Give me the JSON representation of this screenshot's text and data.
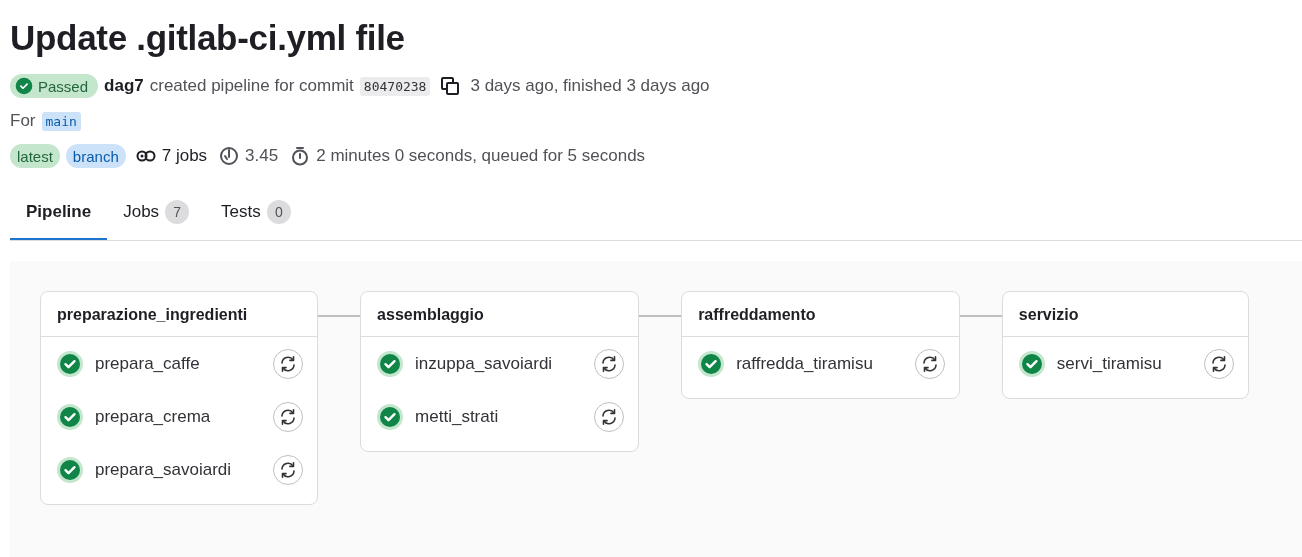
{
  "title": "Update .gitlab-ci.yml file",
  "status": {
    "label": "Passed",
    "kind": "success"
  },
  "author": "dag7",
  "created_text": "created pipeline for commit",
  "commit": "80470238",
  "time_text": "3 days ago, finished 3 days ago",
  "ref": {
    "prefix": "For",
    "name": "main"
  },
  "badges": [
    {
      "label": "latest",
      "kind": "success"
    },
    {
      "label": "branch",
      "kind": "info"
    }
  ],
  "jobs_count": "7 jobs",
  "compute": "3.45",
  "duration": "2 minutes 0 seconds, queued for 5 seconds",
  "tabs": [
    {
      "label": "Pipeline",
      "selected": true
    },
    {
      "label": "Jobs",
      "count": "7",
      "selected": false
    },
    {
      "label": "Tests",
      "count": "0",
      "selected": false
    }
  ],
  "stages": [
    {
      "name": "preparazione_ingredienti",
      "jobs": [
        {
          "name": "prepara_caffe",
          "passed": true
        },
        {
          "name": "prepara_crema",
          "passed": true
        },
        {
          "name": "prepara_savoiardi",
          "passed": true
        }
      ]
    },
    {
      "name": "assemblaggio",
      "jobs": [
        {
          "name": "inzuppa_savoiardi",
          "passed": true
        },
        {
          "name": "metti_strati",
          "passed": true
        }
      ]
    },
    {
      "name": "raffreddamento",
      "jobs": [
        {
          "name": "raffredda_tiramisu",
          "passed": true
        }
      ]
    },
    {
      "name": "servizio",
      "jobs": [
        {
          "name": "servi_tiramisu",
          "passed": true
        }
      ]
    }
  ]
}
